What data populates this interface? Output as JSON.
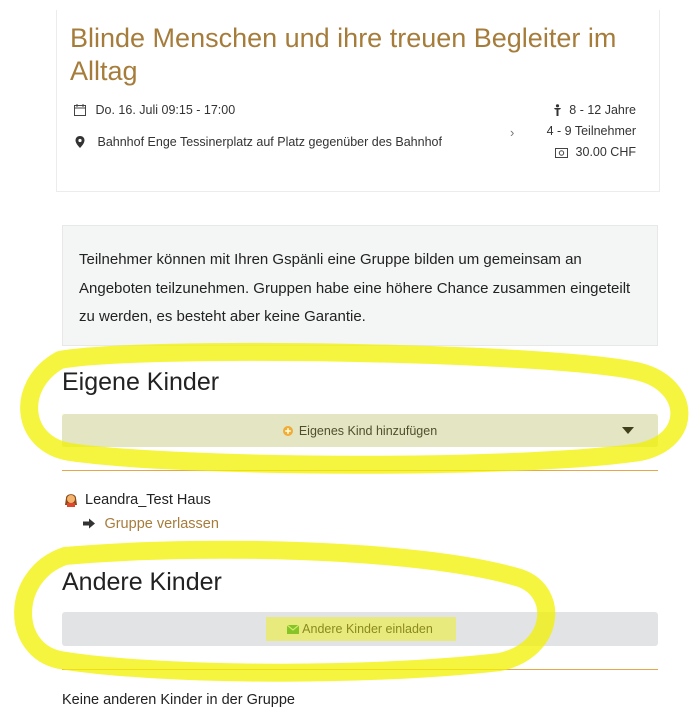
{
  "event": {
    "title_line1": "Blinde Menschen und ihre treuen Begleiter im",
    "title_line2": "Alltag",
    "date": "Do. 16. Juli 09:15 - 17:00",
    "location": "Bahnhof Enge Tessinerplatz auf Platz gegenüber des Bahnhof",
    "age": "8 - 12 Jahre",
    "participants": "4 - 9 Teilnehmer",
    "price": "30.00 CHF"
  },
  "info_text": "Teilnehmer können mit Ihren Gspänli eine Gruppe bilden um gemeinsam an Angeboten teilzunehmen. Gruppen habe eine höhere Chance zusammen eingeteilt zu werden, es besteht aber keine Garantie.",
  "own_children": {
    "heading": "Eigene Kinder",
    "add_label": "Eigenes Kind hinzufügen",
    "member_name": "Leandra_Test Haus",
    "leave_label": "Gruppe verlassen"
  },
  "other_children": {
    "heading": "Andere Kinder",
    "invite_label": "Andere Kinder einladen",
    "empty_text": "Keine anderen Kinder in der Gruppe"
  },
  "colors": {
    "accent": "#a67c3b",
    "divider": "#e8a64a",
    "highlight": "#f2f200",
    "invite_icon": "#2e9e4a",
    "add_icon": "#f0a040"
  },
  "icons": [
    "calendar-icon",
    "map-pin-icon",
    "child-icon",
    "chevron-right-icon",
    "money-icon",
    "plus-circle-icon",
    "caret-down-icon",
    "avatar-icon",
    "sign-out-icon",
    "envelope-icon"
  ]
}
